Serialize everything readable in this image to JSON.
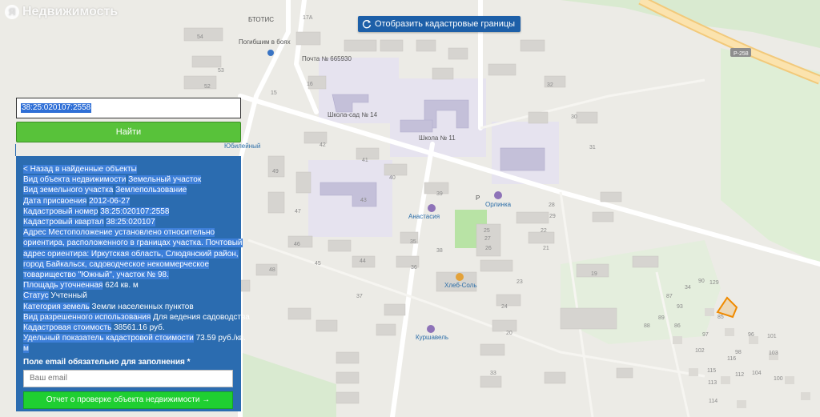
{
  "brand": {
    "logo_letter": "Я",
    "name": "Недвижимость"
  },
  "map": {
    "toggle_label": "Отобразить кадастровые границы",
    "road_label": "Р-258",
    "poi": {
      "btotis": "БТОТИС",
      "memorial": "Погибшим в боях",
      "post": "Почта № 665930",
      "school_kindergarten": "Школа-сад № 14",
      "school": "Школа № 11",
      "jubilee": "Юбилейный",
      "anastasia": "Анастасия",
      "orlinka": "Орлинка",
      "hleb_sol": "Хлеб-Соль",
      "kurshavel": "Куршавель",
      "parking": "P"
    },
    "house_numbers": [
      "54",
      "53",
      "52",
      "17А",
      "16",
      "15",
      "42",
      "49",
      "47",
      "43",
      "41",
      "40",
      "39",
      "38",
      "36",
      "35",
      "37",
      "46",
      "45",
      "44",
      "48",
      "26",
      "25",
      "23",
      "24",
      "27",
      "28",
      "22",
      "21",
      "20",
      "19",
      "29",
      "30",
      "31",
      "32",
      "33",
      "34",
      "90",
      "129",
      "93",
      "89",
      "86",
      "88",
      "87",
      "85",
      "97",
      "96",
      "101",
      "103",
      "98",
      "100",
      "104",
      "112",
      "113",
      "114",
      "115",
      "116",
      "102",
      "95"
    ]
  },
  "search": {
    "value": "38:25:020107:2558",
    "button_label": "Найти"
  },
  "results": {
    "back_label": "< Назад в найденные объекты",
    "fields": [
      {
        "key": "Вид объекта недвижимости",
        "value": "Земельный участок"
      },
      {
        "key": "Вид земельного участка",
        "value": "Землепользование"
      },
      {
        "key": "Дата присвоения",
        "value": "2012-06-27"
      },
      {
        "key": "Кадастровый номер",
        "value": "38:25:020107:2558"
      },
      {
        "key": "Кадастровый квартал",
        "value": "38:25:020107"
      }
    ],
    "address_lines": [
      "Адрес Местоположение установлено относительно",
      "ориентира, расположенного в границах участка. Почтовый",
      "адрес ориентира: Иркутская область, Слюдянский район,",
      "город Байкальск, садоводческое некоммерческое",
      "товарищество \"Южный\", участок № 98."
    ],
    "area_key": "Площадь уточненная",
    "area_value": "624 кв. м",
    "status_key": "Статус",
    "status_value": "Учтенный",
    "category_key": "Категория земель",
    "category_value": "Земли населенных пунктов",
    "usage_key": "Вид разрешенного использования",
    "usage_value": "Для ведения садоводства",
    "cost_key": "Кадастровая стоимость",
    "cost_value": "38561.16 руб.",
    "unit_cost_key": "Удельный показатель кадастровой стоимости",
    "unit_cost_value": "73.59 руб./кв.",
    "unit_cost_tail": "м",
    "email_label": "Поле email обязательно для заполнения *",
    "email_placeholder": "Ваш email",
    "report_button": "Отчет о проверке объекта недвижимости →"
  },
  "colors": {
    "panel": "#2b6cb0",
    "find_button": "#58c23a",
    "report_button": "#1fcf31",
    "toggle_button": "#1d5fa8",
    "parcel_outline": "#f08a00"
  }
}
